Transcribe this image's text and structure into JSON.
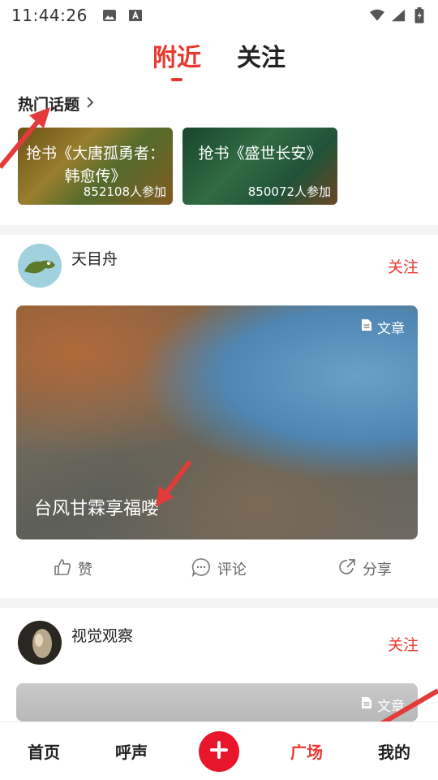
{
  "status_bar": {
    "time": "11:44:26"
  },
  "top_tabs": [
    {
      "label": "附近",
      "active": true
    },
    {
      "label": "关注",
      "active": false
    }
  ],
  "hot_topics": {
    "title": "热门话题",
    "cards": [
      {
        "title": "抢书《大唐孤勇者：韩愈传》",
        "count": "852108人参加"
      },
      {
        "title": "抢书《盛世长安》",
        "count": "850072人参加"
      }
    ]
  },
  "posts": [
    {
      "author": "天目舟",
      "follow": "关注",
      "badge": "文章",
      "caption": "台风甘霖享福喽",
      "actions": {
        "like": "赞",
        "comment": "评论",
        "share": "分享"
      }
    },
    {
      "author": "视觉观察",
      "follow": "关注",
      "badge": "文章"
    }
  ],
  "bottom_nav": [
    {
      "label": "首页",
      "active": false
    },
    {
      "label": "呼声",
      "active": false
    },
    {
      "label": "广场",
      "active": true
    },
    {
      "label": "我的",
      "active": false
    }
  ],
  "colors": {
    "accent": "#e8392f",
    "plus": "#e8162b",
    "annotation_arrow": "#e33b3b"
  },
  "icons": [
    "image-icon",
    "a-box-icon",
    "wifi-icon",
    "signal-icon",
    "battery-icon",
    "chevron-right-icon",
    "document-icon",
    "thumbs-up-icon",
    "comment-icon",
    "share-icon",
    "plus-icon"
  ]
}
